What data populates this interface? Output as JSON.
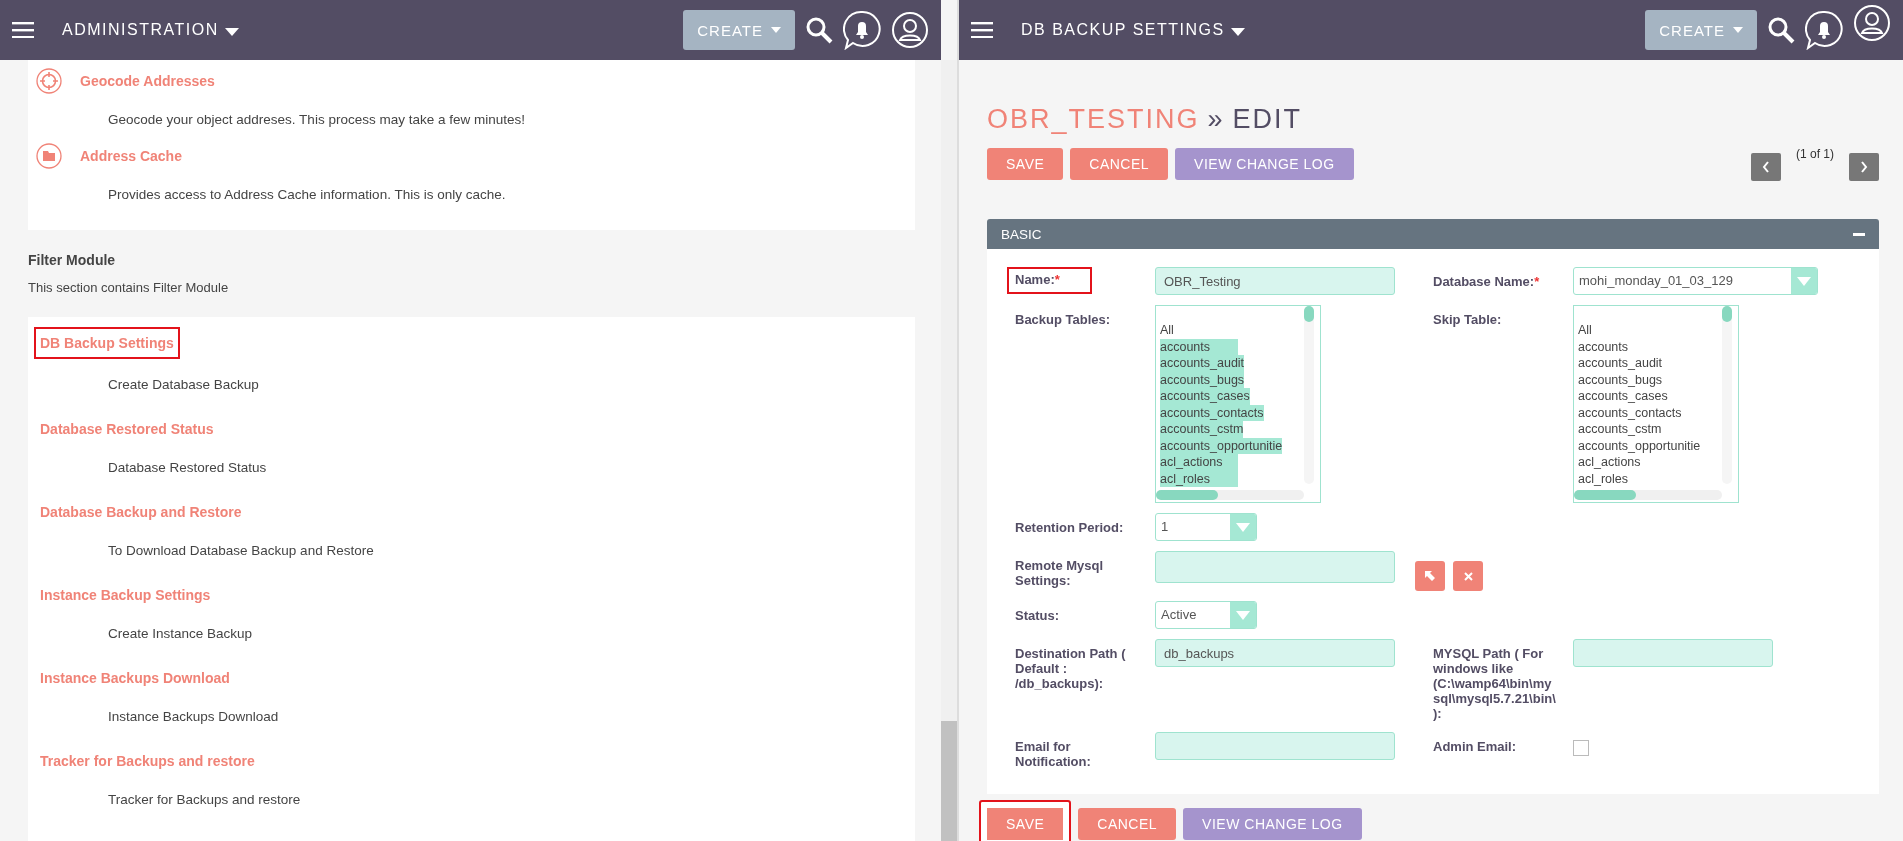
{
  "left_pane": {
    "header": {
      "title": "ADMINISTRATION",
      "create_label": "CREATE"
    },
    "top_card": {
      "items": [
        {
          "title": "Geocode Addresses",
          "description": "Geocode your object addreses. This process may take a few minutes!"
        },
        {
          "title": "Address Cache",
          "description": "Provides access to Address Cache information. This is only cache."
        }
      ]
    },
    "section": {
      "title": "Filter Module",
      "description": "This section contains Filter Module"
    },
    "bottom_card": {
      "items": [
        {
          "title": "DB Backup Settings",
          "description": "Create Database Backup",
          "highlighted": true
        },
        {
          "title": "Database Restored Status",
          "description": "Database Restored Status",
          "highlighted": false
        },
        {
          "title": "Database Backup and Restore",
          "description": "To Download Database Backup and Restore",
          "highlighted": false
        },
        {
          "title": "Instance Backup Settings",
          "description": "Create Instance Backup",
          "highlighted": false
        },
        {
          "title": "Instance Backups Download",
          "description": "Instance Backups Download",
          "highlighted": false
        },
        {
          "title": "Tracker for Backups and restore",
          "description": "Tracker for Backups and restore",
          "highlighted": false
        }
      ]
    }
  },
  "right_pane": {
    "header": {
      "title": "DB BACKUP SETTINGS",
      "create_label": "CREATE"
    },
    "page_title": {
      "record": "OBR_TESTING",
      "separator": "»",
      "action": "EDIT"
    },
    "top_buttons": [
      {
        "label": "SAVE",
        "kind": "save",
        "highlighted": false
      },
      {
        "label": "CANCEL",
        "kind": "cancel",
        "highlighted": false
      },
      {
        "label": "VIEW CHANGE LOG",
        "kind": "log",
        "highlighted": false
      }
    ],
    "pagination": "(1 of 1)",
    "panel": {
      "title": "BASIC",
      "rows": [
        {
          "left": {
            "label": "Name:",
            "required_mark": "*",
            "highlighted": true,
            "kind": "text",
            "value": "OBR_Testing"
          },
          "right": {
            "label": "Database Name:",
            "required_mark": "*",
            "highlighted": false,
            "kind": "select",
            "value": "mohi_monday_01_03_129"
          }
        },
        {
          "left": {
            "label": "Backup Tables:",
            "highlighted": false,
            "kind": "multiselect",
            "options": [
              {
                "text": "All",
                "selected": false
              },
              {
                "text": "accounts",
                "selected": true
              },
              {
                "text": "accounts_audit",
                "selected": true
              },
              {
                "text": "accounts_bugs",
                "selected": true
              },
              {
                "text": "accounts_cases",
                "selected": true
              },
              {
                "text": "accounts_contacts",
                "selected": true
              },
              {
                "text": "accounts_cstm",
                "selected": true
              },
              {
                "text": "accounts_opportunitie",
                "selected": true
              },
              {
                "text": "acl_actions",
                "selected": true
              },
              {
                "text": "acl_roles",
                "selected": true
              }
            ]
          },
          "right": {
            "label": "Skip Table:",
            "highlighted": false,
            "kind": "multiselect",
            "options": [
              {
                "text": "All",
                "selected": false
              },
              {
                "text": "accounts",
                "selected": false
              },
              {
                "text": "accounts_audit",
                "selected": false
              },
              {
                "text": "accounts_bugs",
                "selected": false
              },
              {
                "text": "accounts_cases",
                "selected": false
              },
              {
                "text": "accounts_contacts",
                "selected": false
              },
              {
                "text": "accounts_cstm",
                "selected": false
              },
              {
                "text": "accounts_opportunitie",
                "selected": false
              },
              {
                "text": "acl_actions",
                "selected": false
              },
              {
                "text": "acl_roles",
                "selected": false
              }
            ]
          }
        },
        {
          "left": {
            "label": "Retention Period:",
            "highlighted": false,
            "kind": "small_select",
            "value": "1"
          }
        },
        {
          "left": {
            "label": "Remote Mysql Settings:",
            "highlighted": false,
            "kind": "relate"
          }
        },
        {
          "left": {
            "label": "Status:",
            "highlighted": false,
            "kind": "small_select",
            "value": "Active"
          }
        },
        {
          "left": {
            "label": "Destination Path ( Default : /db_backups):",
            "highlighted": false,
            "kind": "text",
            "value": "db_backups"
          },
          "right": {
            "label": "MYSQL Path ( For windows like (C:\\wamp64\\bin\\mysql\\mysql5.7.21\\bin\\):",
            "highlighted": false,
            "kind": "text"
          }
        },
        {
          "left": {
            "label": "Email for Notification:",
            "highlighted": false,
            "kind": "text"
          },
          "right": {
            "label": "Admin Email:",
            "highlighted": false,
            "kind": "checkbox",
            "checked": false
          }
        }
      ]
    },
    "bottom_buttons": [
      {
        "label": "SAVE",
        "kind": "save",
        "highlighted": true
      },
      {
        "label": "CANCEL",
        "kind": "cancel",
        "highlighted": false
      },
      {
        "label": "VIEW CHANGE LOG",
        "kind": "log",
        "highlighted": false
      }
    ]
  }
}
